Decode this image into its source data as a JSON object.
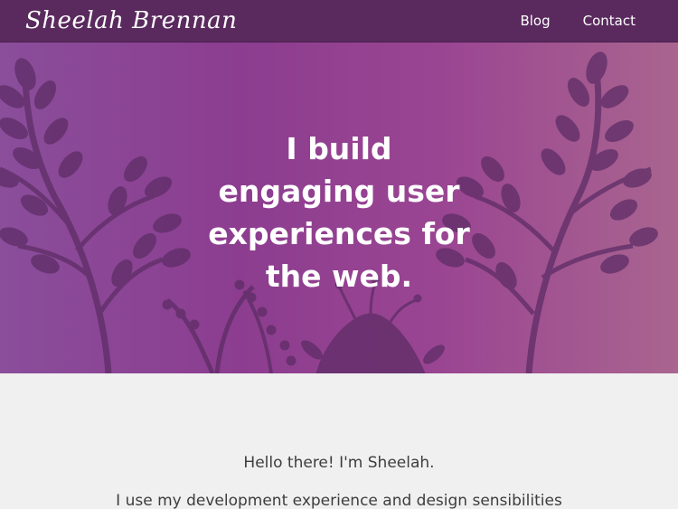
{
  "header": {
    "logo_text": "Sheelah Brennan",
    "nav": [
      {
        "label": "Blog"
      },
      {
        "label": "Contact"
      }
    ]
  },
  "hero": {
    "lines": [
      "I build",
      "engaging user",
      "experiences for",
      "the web."
    ],
    "colors": {
      "gradient_left": "#8a4e9b",
      "gradient_mid": "#8c3d8f",
      "gradient_right": "#a9658f",
      "plant_silhouette": "#5e2d66"
    },
    "illustration": "plant-silhouettes"
  },
  "intro": {
    "greeting": "Hello there! I'm Sheelah.",
    "text": "I use my development experience and design sensibilities"
  },
  "colors": {
    "header_bg": "#5a2a5e",
    "page_bg": "#f0f0f0",
    "text": "#3d3d3d"
  }
}
